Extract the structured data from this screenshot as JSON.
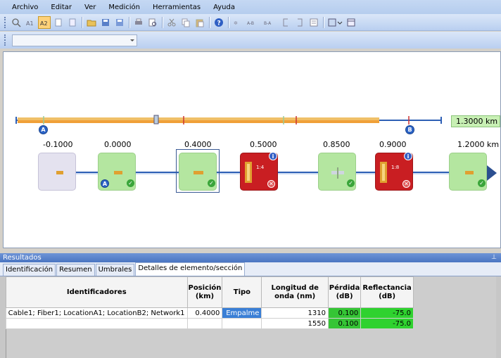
{
  "menu": {
    "items": [
      "Archivo",
      "Editar",
      "Ver",
      "Medición",
      "Herramientas",
      "Ayuda"
    ]
  },
  "toolbar": {
    "icons": [
      "zoom-icon",
      "marker-a1-icon",
      "marker-a2-icon",
      "page-icon",
      "page2-icon",
      "open-folder-icon",
      "save-icon",
      "save-as-icon",
      "print-icon",
      "print-preview-icon",
      "cut-icon",
      "copy-icon",
      "paste-icon",
      "help-icon",
      "ab-marker-icon",
      "a-b-icon",
      "b-a-icon",
      "bracket-left-icon",
      "bracket-right-icon",
      "report-icon",
      "window-icon",
      "layout-icon"
    ],
    "combo_value": ""
  },
  "trace": {
    "length_value": "1.3000 km",
    "marker_a": "A",
    "marker_b": "B",
    "distances": [
      "-0.1000",
      "0.0000",
      "0.4000",
      "0.5000",
      "0.8500",
      "0.9000",
      "1.2000"
    ],
    "distance_unit": "km",
    "splitter_1_label": "1:4",
    "splitter_2_label": "1:8"
  },
  "results": {
    "title": "Resultados",
    "tabs": [
      "Identificación",
      "Resumen",
      "Umbrales",
      "Detalles de elemento/sección"
    ],
    "active_tab_index": 3,
    "columns": [
      "Identificadores",
      "Posición (km)",
      "Tipo",
      "Longitud de onda (nm)",
      "Pérdida (dB)",
      "Reflectancia (dB)"
    ],
    "rows": [
      [
        "Cable1; Fiber1; LocationA1; LocationB2; Network1",
        "0.4000",
        "Empalme",
        "1310",
        "0.100",
        "-75.0"
      ],
      [
        "",
        "",
        "",
        "1550",
        "0.100",
        "-75.0"
      ]
    ]
  },
  "colors": {
    "pass": "#b4e6a0",
    "fail": "#c91e22",
    "accent": "#2b63c6"
  }
}
